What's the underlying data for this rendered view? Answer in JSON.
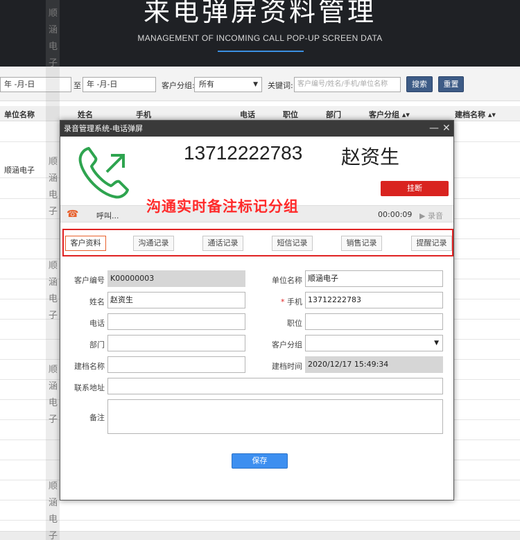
{
  "banner": {
    "title": "来电弹屏资料管理",
    "subtitle": "MANAGEMENT OF INCOMING CALL POP-UP SCREEN DATA"
  },
  "watermark": [
    "顺",
    "涵",
    "电",
    "子"
  ],
  "filters": {
    "date_start": "年 -月-日",
    "date_to_label": "至",
    "date_end": "年 -月-日",
    "group_label": "客户分组:",
    "group_value": "所有",
    "keyword_label": "关键词:",
    "keyword_placeholder": "客户编号/姓名/手机/单位名称",
    "search_label": "搜索",
    "reset_label": "重置"
  },
  "table": {
    "headers": [
      "单位名称",
      "姓名",
      "手机",
      "电话",
      "职位",
      "部门",
      "客户分组",
      "建档名称"
    ],
    "rows": [
      [
        "顺涵电子"
      ]
    ]
  },
  "popup": {
    "title": "录音管理系统-电话弹屏",
    "minimize": "—",
    "close": "✕",
    "phone_number": "13712222783",
    "caller_name": "赵资生",
    "hangup_label": "挂断",
    "annotation": "沟通实时备注标记分组",
    "status_text": "呼叫...",
    "duration": "00:00:09",
    "record_label": "录音",
    "tabs": [
      "客户资料",
      "沟通记录",
      "通话记录",
      "短信记录",
      "销售记录",
      "提醒记录"
    ],
    "form": {
      "customer_no_label": "客户编号",
      "customer_no": "K00000003",
      "company_label": "单位名称",
      "company": "顺涵电子",
      "name_label": "姓名",
      "name": "赵资生",
      "mobile_label": "手机",
      "mobile": "13712222783",
      "phone_label": "电话",
      "position_label": "职位",
      "dept_label": "部门",
      "group_label": "客户分组",
      "archive_label": "建档名称",
      "archive_time_label": "建档时间",
      "archive_time": "2020/12/17 15:49:34",
      "address_label": "联系地址",
      "remark_label": "备注",
      "save_label": "保存"
    }
  }
}
